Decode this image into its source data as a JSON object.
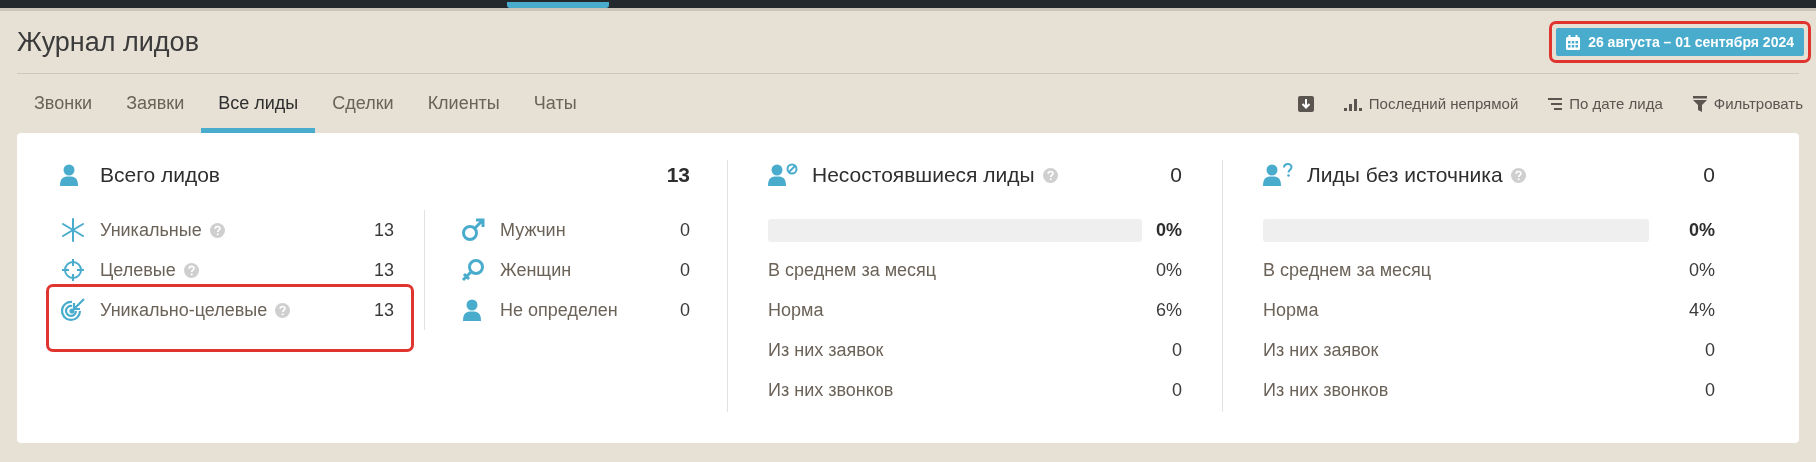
{
  "header": {
    "title": "Журнал лидов",
    "date_range": {
      "label": "26 августа – 01 сентября 2024",
      "highlighted": true
    }
  },
  "tabs": [
    {
      "label": "Звонки",
      "selected": false
    },
    {
      "label": "Заявки",
      "selected": false
    },
    {
      "label": "Все лиды",
      "selected": true
    },
    {
      "label": "Сделки",
      "selected": false
    },
    {
      "label": "Клиенты",
      "selected": false
    },
    {
      "label": "Чаты",
      "selected": false
    }
  ],
  "toolbar": [
    {
      "kind": "download"
    },
    {
      "kind": "attribution",
      "label": "Последний непрямой"
    },
    {
      "kind": "sort",
      "label": "По дате лида"
    },
    {
      "kind": "filter",
      "label": "Фильтровать"
    }
  ],
  "total": {
    "title": "Всего лидов",
    "count": "13",
    "breakdown": [
      {
        "kind": "unique",
        "label": "Уникальные",
        "help": true,
        "value": "13",
        "highlighted": false
      },
      {
        "kind": "target",
        "label": "Целевые",
        "help": true,
        "value": "13",
        "highlighted": false
      },
      {
        "kind": "unique_target",
        "label": "Уникально-целевые",
        "help": true,
        "value": "13",
        "highlighted": true
      }
    ],
    "gender": [
      {
        "kind": "male",
        "label": "Мужчин",
        "value": "0"
      },
      {
        "kind": "female",
        "label": "Женщин",
        "value": "0"
      },
      {
        "kind": "unknown",
        "label": "Не определен",
        "value": "0"
      }
    ]
  },
  "panels": [
    {
      "kind": "failed",
      "title": "Несостоявшиеся лиды",
      "help": true,
      "count": "0",
      "level": 0,
      "percent": "0%",
      "rows": [
        {
          "label": "В среднем за месяц",
          "value": "0%"
        },
        {
          "label": "Норма",
          "value": "6%"
        },
        {
          "label": "Из них заявок",
          "value": "0"
        },
        {
          "label": "Из них звонков",
          "value": "0"
        }
      ]
    },
    {
      "kind": "no_source",
      "title": "Лиды без источника",
      "help": true,
      "count": "0",
      "level": 0,
      "percent": "0%",
      "rows": [
        {
          "label": "В среднем за месяц",
          "value": "0%"
        },
        {
          "label": "Норма",
          "value": "4%"
        },
        {
          "label": "Из них заявок",
          "value": "0"
        },
        {
          "label": "Из них звонков",
          "value": "0"
        }
      ]
    }
  ]
}
